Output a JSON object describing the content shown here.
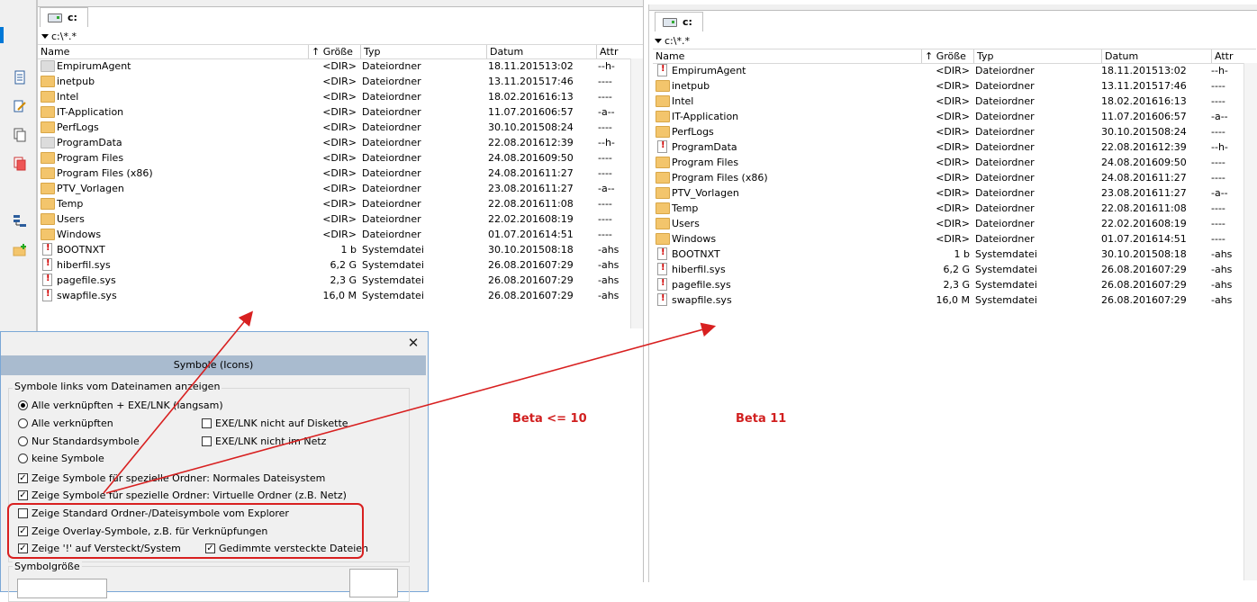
{
  "left": {
    "tab_label": "c:",
    "path": "c:\\*.*",
    "columns": {
      "name": "Name",
      "size": "Größe",
      "sort_arrow": "↑",
      "type": "Typ",
      "date": "Datum",
      "attr": "Attr"
    },
    "rows": [
      {
        "name": "EmpirumAgent",
        "icon": "folder-gray",
        "size": "<DIR>",
        "type": "Dateiordner",
        "date": "18.11.2015",
        "time": "13:02",
        "attr": "--h-"
      },
      {
        "name": "inetpub",
        "icon": "folder",
        "size": "<DIR>",
        "type": "Dateiordner",
        "date": "13.11.2015",
        "time": "17:46",
        "attr": "----"
      },
      {
        "name": "Intel",
        "icon": "folder",
        "size": "<DIR>",
        "type": "Dateiordner",
        "date": "18.02.2016",
        "time": "16:13",
        "attr": "----"
      },
      {
        "name": "IT-Application",
        "icon": "folder",
        "size": "<DIR>",
        "type": "Dateiordner",
        "date": "11.07.2016",
        "time": "06:57",
        "attr": "-a--"
      },
      {
        "name": "PerfLogs",
        "icon": "folder",
        "size": "<DIR>",
        "type": "Dateiordner",
        "date": "30.10.2015",
        "time": "08:24",
        "attr": "----"
      },
      {
        "name": "ProgramData",
        "icon": "folder-gray",
        "size": "<DIR>",
        "type": "Dateiordner",
        "date": "22.08.2016",
        "time": "12:39",
        "attr": "--h-"
      },
      {
        "name": "Program Files",
        "icon": "folder",
        "size": "<DIR>",
        "type": "Dateiordner",
        "date": "24.08.2016",
        "time": "09:50",
        "attr": "----"
      },
      {
        "name": "Program Files (x86)",
        "icon": "folder",
        "size": "<DIR>",
        "type": "Dateiordner",
        "date": "24.08.2016",
        "time": "11:27",
        "attr": "----"
      },
      {
        "name": "PTV_Vorlagen",
        "icon": "folder",
        "size": "<DIR>",
        "type": "Dateiordner",
        "date": "23.08.2016",
        "time": "11:27",
        "attr": "-a--"
      },
      {
        "name": "Temp",
        "icon": "folder",
        "size": "<DIR>",
        "type": "Dateiordner",
        "date": "22.08.2016",
        "time": "11:08",
        "attr": "----"
      },
      {
        "name": "Users",
        "icon": "folder",
        "size": "<DIR>",
        "type": "Dateiordner",
        "date": "22.02.2016",
        "time": "08:19",
        "attr": "----"
      },
      {
        "name": "Windows",
        "icon": "folder",
        "size": "<DIR>",
        "type": "Dateiordner",
        "date": "01.07.2016",
        "time": "14:51",
        "attr": "----"
      },
      {
        "name": "BOOTNXT",
        "icon": "sysfile",
        "size": "1 b",
        "type": "Systemdatei",
        "date": "30.10.2015",
        "time": "08:18",
        "attr": "-ahs"
      },
      {
        "name": "hiberfil.sys",
        "icon": "sysfile",
        "size": "6,2 G",
        "type": "Systemdatei",
        "date": "26.08.2016",
        "time": "07:29",
        "attr": "-ahs"
      },
      {
        "name": "pagefile.sys",
        "icon": "sysfile",
        "size": "2,3 G",
        "type": "Systemdatei",
        "date": "26.08.2016",
        "time": "07:29",
        "attr": "-ahs"
      },
      {
        "name": "swapfile.sys",
        "icon": "sysfile",
        "size": "16,0 M",
        "type": "Systemdatei",
        "date": "26.08.2016",
        "time": "07:29",
        "attr": "-ahs"
      }
    ]
  },
  "right": {
    "tab_label": "c:",
    "path": "c:\\*.*",
    "columns": {
      "name": "Name",
      "size": "Größe",
      "sort_arrow": "↑",
      "type": "Typ",
      "date": "Datum",
      "attr": "Attr"
    },
    "rows": [
      {
        "name": "EmpirumAgent",
        "icon": "sysfile",
        "size": "<DIR>",
        "type": "Dateiordner",
        "date": "18.11.2015",
        "time": "13:02",
        "attr": "--h-"
      },
      {
        "name": "inetpub",
        "icon": "folder",
        "size": "<DIR>",
        "type": "Dateiordner",
        "date": "13.11.2015",
        "time": "17:46",
        "attr": "----"
      },
      {
        "name": "Intel",
        "icon": "folder",
        "size": "<DIR>",
        "type": "Dateiordner",
        "date": "18.02.2016",
        "time": "16:13",
        "attr": "----"
      },
      {
        "name": "IT-Application",
        "icon": "folder",
        "size": "<DIR>",
        "type": "Dateiordner",
        "date": "11.07.2016",
        "time": "06:57",
        "attr": "-a--"
      },
      {
        "name": "PerfLogs",
        "icon": "folder",
        "size": "<DIR>",
        "type": "Dateiordner",
        "date": "30.10.2015",
        "time": "08:24",
        "attr": "----"
      },
      {
        "name": "ProgramData",
        "icon": "sysfile",
        "size": "<DIR>",
        "type": "Dateiordner",
        "date": "22.08.2016",
        "time": "12:39",
        "attr": "--h-"
      },
      {
        "name": "Program Files",
        "icon": "folder",
        "size": "<DIR>",
        "type": "Dateiordner",
        "date": "24.08.2016",
        "time": "09:50",
        "attr": "----"
      },
      {
        "name": "Program Files (x86)",
        "icon": "folder",
        "size": "<DIR>",
        "type": "Dateiordner",
        "date": "24.08.2016",
        "time": "11:27",
        "attr": "----"
      },
      {
        "name": "PTV_Vorlagen",
        "icon": "folder",
        "size": "<DIR>",
        "type": "Dateiordner",
        "date": "23.08.2016",
        "time": "11:27",
        "attr": "-a--"
      },
      {
        "name": "Temp",
        "icon": "folder",
        "size": "<DIR>",
        "type": "Dateiordner",
        "date": "22.08.2016",
        "time": "11:08",
        "attr": "----"
      },
      {
        "name": "Users",
        "icon": "folder",
        "size": "<DIR>",
        "type": "Dateiordner",
        "date": "22.02.2016",
        "time": "08:19",
        "attr": "----"
      },
      {
        "name": "Windows",
        "icon": "folder",
        "size": "<DIR>",
        "type": "Dateiordner",
        "date": "01.07.2016",
        "time": "14:51",
        "attr": "----"
      },
      {
        "name": "BOOTNXT",
        "icon": "sysfile",
        "size": "1 b",
        "type": "Systemdatei",
        "date": "30.10.2015",
        "time": "08:18",
        "attr": "-ahs"
      },
      {
        "name": "hiberfil.sys",
        "icon": "sysfile",
        "size": "6,2 G",
        "type": "Systemdatei",
        "date": "26.08.2016",
        "time": "07:29",
        "attr": "-ahs"
      },
      {
        "name": "pagefile.sys",
        "icon": "sysfile",
        "size": "2,3 G",
        "type": "Systemdatei",
        "date": "26.08.2016",
        "time": "07:29",
        "attr": "-ahs"
      },
      {
        "name": "swapfile.sys",
        "icon": "sysfile",
        "size": "16,0 M",
        "type": "Systemdatei",
        "date": "26.08.2016",
        "time": "07:29",
        "attr": "-ahs"
      }
    ]
  },
  "dialog": {
    "title": "Symbole (Icons)",
    "close": "✕",
    "group_label": "Symbole links vom Dateinamen anzeigen",
    "radio_all_exe": "Alle verknüpften + EXE/LNK (langsam)",
    "radio_all": "Alle verknüpften",
    "radio_standard": "Nur Standardsymbole",
    "radio_none": "keine Symbole",
    "chk_exe_disk": "EXE/LNK nicht auf Diskette",
    "chk_exe_net": "EXE/LNK nicht im Netz",
    "chk_special_normal": "Zeige Symbole für spezielle Ordner: Normales Dateisystem",
    "chk_special_virtual": "Zeige Symbole für spezielle Ordner: Virtuelle Ordner (z.B. Netz)",
    "chk_explorer_std": "Zeige Standard Ordner-/Dateisymbole vom Explorer",
    "chk_overlay": "Zeige Overlay-Symbole, z.B. für Verknüpfungen",
    "chk_hidden_mark": "Zeige '!' auf Versteckt/System",
    "chk_dimmed": "Gedimmte versteckte Dateien",
    "size_label": "Symbolgröße"
  },
  "annotations": {
    "beta_left": "Beta <= 10",
    "beta_right": "Beta 11"
  },
  "colors": {
    "accent_red": "#d82020",
    "folder": "#f3c56c",
    "dialog_title": "#a9bbcf"
  }
}
